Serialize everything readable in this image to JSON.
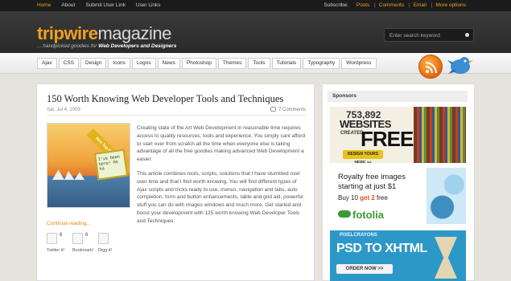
{
  "topbar": {
    "links": [
      "Home",
      "About",
      "Submit User Link",
      "User Links"
    ],
    "subscribe_label": "Subscribe:",
    "subscribe_links": [
      "Posts",
      "Comments",
      "Email",
      "More options"
    ]
  },
  "header": {
    "logo_part1": "tripwire",
    "logo_part2": "magazine",
    "tagline_prefix": "... handpicked goodies for ",
    "tagline_bold": "Web Developers and Designers",
    "search_placeholder": "Enter search keyword"
  },
  "nav": {
    "items": [
      "Ajax",
      "CSS",
      "Design",
      "Icons",
      "Logos",
      "News",
      "Photoshop",
      "Themes",
      "Tools",
      "Tutorials",
      "Typography",
      "Wordpress"
    ]
  },
  "post": {
    "title": "150 Worth Knowing Web Developer Tools and Techniques",
    "date": "Sat, Jul 4, 2009",
    "comments": "7 Comments",
    "thumb_banner": "Hire Top Developers",
    "thumb_card": "I've been here! Ha ha",
    "paragraph1": "Creating state of the Art Web Development in reasonable time requires access to quality resources, tools and experience. You simply cant afford to start over from scratch all the time when everyone else is taking advantage of all the free goodies making advanced Web Development a easier.",
    "paragraph2": "This article combines tools, scripts, solutions that I have stumbled over over time and that I find worth knowing. You will find different types of Ajax scripts and tricks ready to use, menus, navigation and tabs, auto completion, form and button enhancements, table and grid aid, powerful stuff you can do with images windows and much more. Get started and boost your development with 125 worth knowing Web Developer Tools and Techniques.",
    "continue": "Continue reading...",
    "social": [
      {
        "label": "Twitter it!",
        "count": "6"
      },
      {
        "label": "Bookmark!",
        "count": "6"
      },
      {
        "label": "Digg it!",
        "count": ""
      }
    ]
  },
  "sidebar": {
    "heading": "Sponsors",
    "ad1": {
      "number": "753,892",
      "websites": "WEBSITES",
      "created": "CREATED",
      "free": "FREE",
      "button": "DESIGN YOURS HERE >>"
    },
    "ad2": {
      "line1": "Royalty free images",
      "line2": "starting at just $1",
      "buy_prefix": "Buy 10 ",
      "buy_bold": "get 2",
      "buy_suffix": " free",
      "brand": "fotolia"
    },
    "ad3": {
      "brand": "PIXELCRAYONS",
      "headline": "PSD TO XHTML",
      "button": "ORDER NOW >>"
    }
  },
  "colors": {
    "accent": "#f0a020",
    "header_bg": "#2f2f2f",
    "page_bg": "#e6e3dc"
  }
}
